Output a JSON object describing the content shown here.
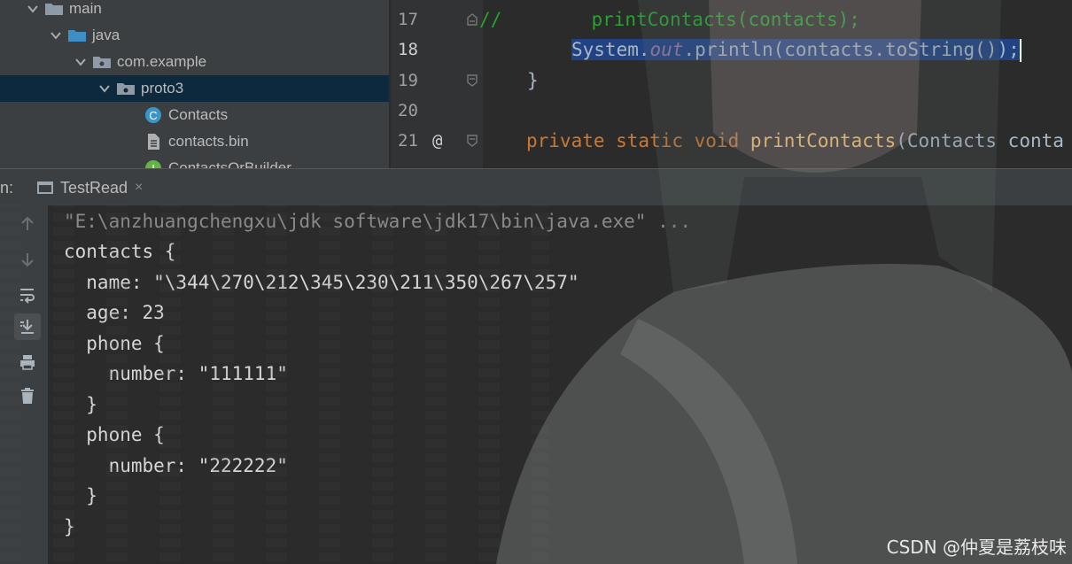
{
  "project_tree": {
    "items": [
      {
        "label": "main",
        "icon": "folder-icon",
        "expanded": true
      },
      {
        "label": "java",
        "icon": "source-folder-icon",
        "expanded": true
      },
      {
        "label": "com.example",
        "icon": "package-icon",
        "expanded": true
      },
      {
        "label": "proto3",
        "icon": "package-icon",
        "expanded": true,
        "selected": true
      },
      {
        "label": "Contacts",
        "icon": "java-class-icon"
      },
      {
        "label": "contacts.bin",
        "icon": "file-icon"
      },
      {
        "label": "ContactsOrBuilder",
        "icon": "interface-icon"
      }
    ]
  },
  "editor": {
    "line_numbers": [
      "17",
      "18",
      "19",
      "20",
      "21"
    ],
    "line17": {
      "comment_slashes": "//",
      "text": "        printContacts(contacts);"
    },
    "line18": {
      "a": "System.",
      "b": "out",
      "c": ".println(contacts.toString());"
    },
    "line19": {
      "text": "}"
    },
    "line21": {
      "marker": "@",
      "kw": "private static void ",
      "fn": "printContacts",
      "rest": "(Contacts conta"
    }
  },
  "run_panel": {
    "label": "n:",
    "tab_label": "TestRead",
    "tab_close": "×"
  },
  "console": {
    "lines": [
      "\"E:\\anzhuangchengxu\\jdk software\\jdk17\\bin\\java.exe\" ...",
      "contacts {",
      "  name: \"\\344\\270\\212\\345\\230\\211\\350\\267\\257\"",
      "  age: 23",
      "  phone {",
      "    number: \"111111\"",
      "  }",
      "  phone {",
      "    number: \"222222\"",
      "  }",
      "}"
    ]
  },
  "watermark": "CSDN @仲夏是荔枝味",
  "colors": {
    "keyword": "#cc7832",
    "comment": "#27a331",
    "function": "#ffc66d",
    "static_field": "#9876aa",
    "selection": "#214283",
    "panel": "#3c3f41",
    "editor_bg": "#2b2b2b"
  }
}
